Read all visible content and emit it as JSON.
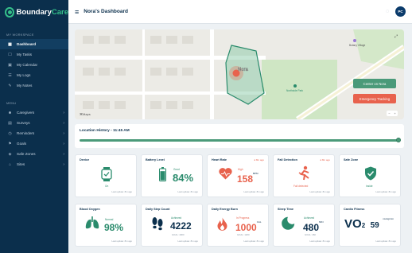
{
  "app": {
    "brand_first": "Boundary",
    "brand_second": "Care",
    "page_title": "Nora's Dashboard",
    "avatar_initials": "PC"
  },
  "sidebar": {
    "workspace_heading": "MY WORKSPACE",
    "workspace_items": [
      {
        "label": "Dashboard",
        "icon": "grid-icon"
      },
      {
        "label": "My Tasks",
        "icon": "tasks-icon"
      },
      {
        "label": "My Calendar",
        "icon": "calendar-icon"
      },
      {
        "label": "My Logs",
        "icon": "logs-icon"
      },
      {
        "label": "My Notes",
        "icon": "notes-icon"
      }
    ],
    "menu_heading": "MENU",
    "menu_items": [
      {
        "label": "Caregivers",
        "icon": "people-icon"
      },
      {
        "label": "Surveys",
        "icon": "survey-icon"
      },
      {
        "label": "Reminders",
        "icon": "reminder-icon"
      },
      {
        "label": "Goals",
        "icon": "flag-icon"
      },
      {
        "label": "Safe Zones",
        "icon": "shield-icon"
      },
      {
        "label": "Sites",
        "icon": "site-icon"
      }
    ]
  },
  "map": {
    "marker_label": "Nora",
    "place_top_right": "Botany Village",
    "place_park": "Northside Park",
    "attribution": "Maps",
    "center_button": "Center on Nora",
    "emergency_button": "Emergency Tracking"
  },
  "history": {
    "title": "Location History - 11:45 AM",
    "position_percent": 100
  },
  "cards": {
    "device": {
      "title": "Device",
      "status": "On",
      "foot": "Last update: 8m ago"
    },
    "battery": {
      "title": "Battery Level",
      "status": "Good",
      "value": "84%",
      "level_percent": 84,
      "foot": "Last update: 8m ago"
    },
    "heart": {
      "title": "Heart Rate",
      "flag": "● 8m ago",
      "status": "High",
      "value": "158",
      "unit": "BPM",
      "foot": "Last update: 8m ago"
    },
    "fall": {
      "title": "Fall Detection",
      "flag": "● 8m ago",
      "status": "Fall detected",
      "foot": "Last update: 8m ago"
    },
    "safe": {
      "title": "Safe Zone",
      "status": "Inside",
      "foot": "Last update: 8m ago"
    },
    "oxygen": {
      "title": "Blood Oxygen",
      "status": "Normal",
      "value": "98%",
      "foot": "Last update: 8m ago"
    },
    "steps": {
      "title": "Daily Step Count",
      "status": "Achieved",
      "value": "4222",
      "goal": "GOAL: 4000",
      "foot": "Last update: 8m ago"
    },
    "energy": {
      "title": "Daily Energy Burn",
      "status": "In Progress",
      "value": "1000",
      "unit": "CAL",
      "goal": "GOAL: 1200",
      "foot": "Last update: 8m ago"
    },
    "sleep": {
      "title": "Sleep Time",
      "status": "Achieved",
      "value": "480",
      "unit": "MIN",
      "goal": "GOAL: 460",
      "foot": "Last update: 8m ago"
    },
    "fitness": {
      "title": "Cardio Fitness",
      "value_prefix": "VO",
      "value_sub": "2",
      "value": "59",
      "unit": "mL/kg/min",
      "foot": "Last update: 8m ago"
    }
  },
  "colors": {
    "sidebar": "#0b2f4c",
    "accent": "#2a8b6c",
    "alert": "#e8624d",
    "card_background": "#ffffff"
  }
}
